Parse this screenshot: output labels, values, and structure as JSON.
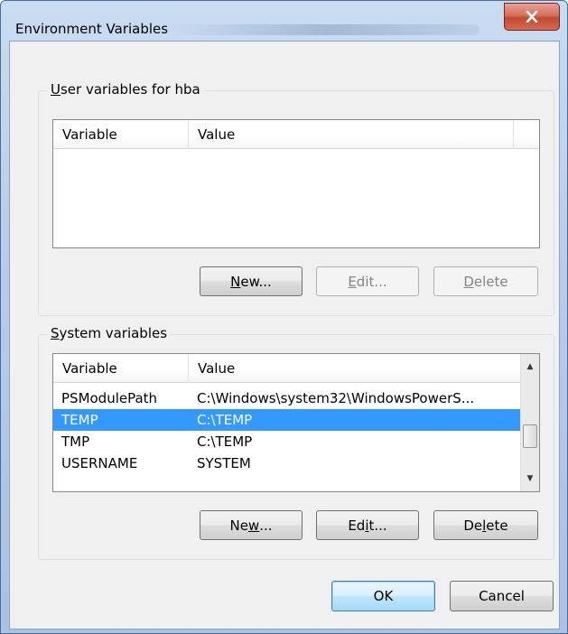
{
  "window": {
    "title": "Environment Variables"
  },
  "icons": {
    "close": "close-icon",
    "scroll_up": "scroll-up-icon",
    "scroll_down": "scroll-down-icon"
  },
  "user_vars": {
    "group_label_pre": "",
    "group_label_key": "U",
    "group_label_post": "ser variables for hba",
    "columns": [
      "Variable",
      "Value"
    ],
    "rows": [],
    "buttons": {
      "new": {
        "key": "N",
        "rest": "ew..."
      },
      "edit": {
        "key": "E",
        "rest": "dit..."
      },
      "delete": {
        "key": "D",
        "rest": "elete"
      }
    }
  },
  "system_vars": {
    "group_label_pre": "",
    "group_label_key": "S",
    "group_label_post": "ystem variables",
    "columns": [
      "Variable",
      "Value"
    ],
    "rows": [
      {
        "variable": "PSModulePath",
        "value": "C:\\Windows\\system32\\WindowsPowerS..."
      },
      {
        "variable": "TEMP",
        "value": "C:\\TEMP",
        "selected": true
      },
      {
        "variable": "TMP",
        "value": "C:\\TEMP"
      },
      {
        "variable": "USERNAME",
        "value": "SYSTEM"
      }
    ],
    "buttons": {
      "new": {
        "pre": "Ne",
        "key": "w",
        "rest": "..."
      },
      "edit": {
        "pre": "Ed",
        "key": "i",
        "rest": "t..."
      },
      "delete": {
        "pre": "De",
        "key": "l",
        "rest": "ete"
      }
    }
  },
  "footer": {
    "ok": "OK",
    "cancel": "Cancel"
  },
  "colors": {
    "selection": "#3399ff",
    "close_button": "#c7432b"
  }
}
